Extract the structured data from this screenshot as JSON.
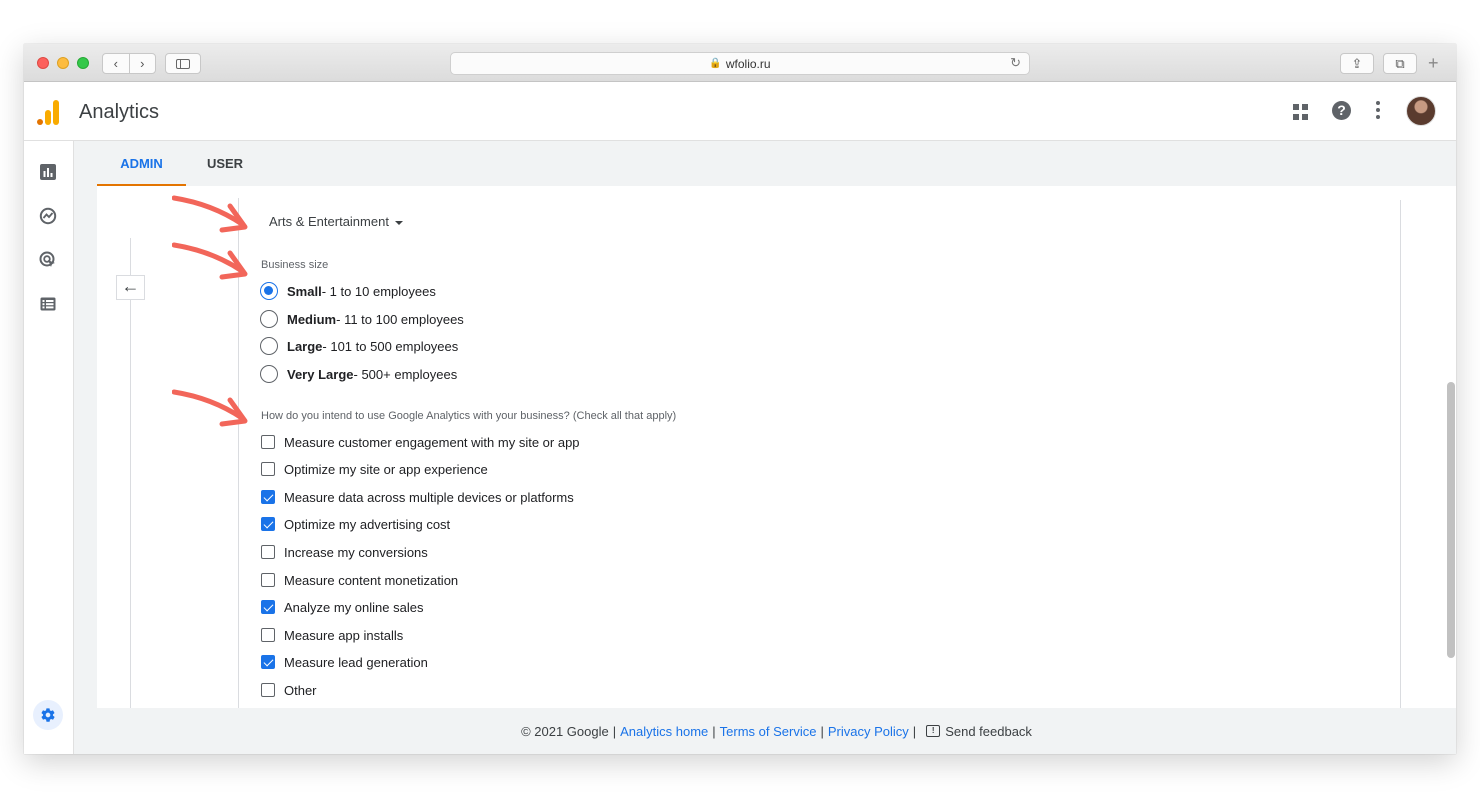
{
  "browser": {
    "url": "wfolio.ru",
    "back_glyph": "‹",
    "forward_glyph": "›",
    "reload_glyph": "↻",
    "share_glyph": "⇪",
    "tabs_glyph": "⧉",
    "plus_glyph": "+",
    "lock_glyph": "🔒"
  },
  "header": {
    "app_title": "Analytics"
  },
  "tabs": {
    "admin": "ADMIN",
    "user": "USER"
  },
  "form": {
    "back_glyph": "←",
    "category": "Arts & Entertainment",
    "business_size_label": "Business size",
    "sizes": [
      {
        "name": "Small",
        "detail": " - 1 to 10 employees",
        "selected": true
      },
      {
        "name": "Medium",
        "detail": " - 11 to 100 employees",
        "selected": false
      },
      {
        "name": "Large",
        "detail": " - 101 to 500 employees",
        "selected": false
      },
      {
        "name": "Very Large",
        "detail": " - 500+ employees",
        "selected": false
      }
    ],
    "usage_label": "How do you intend to use Google Analytics with your business? (Check all that apply)",
    "usages": [
      {
        "label": "Measure customer engagement with my site or app",
        "checked": false
      },
      {
        "label": "Optimize my site or app experience",
        "checked": false
      },
      {
        "label": "Measure data across multiple devices or platforms",
        "checked": true
      },
      {
        "label": "Optimize my advertising cost",
        "checked": true
      },
      {
        "label": "Increase my conversions",
        "checked": false
      },
      {
        "label": "Measure content monetization",
        "checked": false
      },
      {
        "label": "Analyze my online sales",
        "checked": true
      },
      {
        "label": "Measure app installs",
        "checked": false
      },
      {
        "label": "Measure lead generation",
        "checked": true
      },
      {
        "label": "Other",
        "checked": false
      }
    ]
  },
  "footer": {
    "copyright": "© 2021 Google",
    "home": "Analytics home",
    "tos": "Terms of Service",
    "privacy": "Privacy Policy",
    "feedback": "Send feedback",
    "divider": "|"
  },
  "colors": {
    "accent": "#1a73e8",
    "tab_underline": "#e37400",
    "annotation_arrow": "#f2665a"
  }
}
